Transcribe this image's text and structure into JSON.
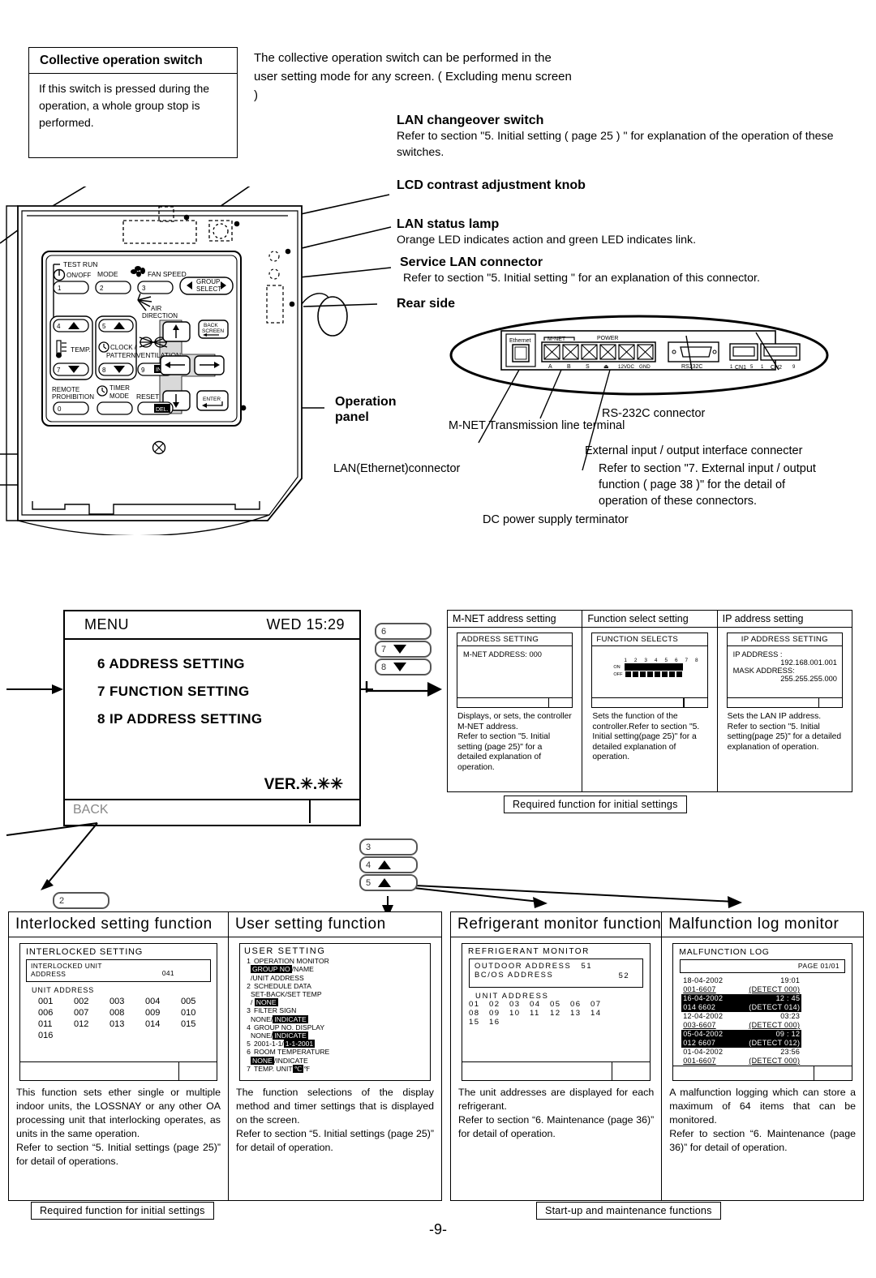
{
  "page_number": "-9-",
  "collective_box": {
    "title": "Collective operation switch",
    "body": "If this switch is pressed during the operation, a whole group stop is performed."
  },
  "intro_text": "The collective operation switch can be performed in the user setting mode for any screen. ( Excluding menu screen )",
  "callouts": [
    {
      "title": "LAN changeover switch",
      "body": "Refer to section \"5. Initial setting ( page 25 ) \" for explanation of the operation of these switches."
    },
    {
      "title": "LCD contrast adjustment knob",
      "body": ""
    },
    {
      "title": "LAN status lamp",
      "body": "Orange LED indicates action and green LED indicates link."
    },
    {
      "title": "Service LAN connector",
      "body": "Refer to section \"5. Initial setting \" for an explanation of this connector."
    },
    {
      "title": "Rear side",
      "body": ""
    }
  ],
  "operation_panel_label": "Operation\npanel",
  "panel_keys": {
    "test_run": "TEST RUN",
    "on_off": "ON/OFF",
    "mode": "MODE",
    "fan_speed": "FAN SPEED",
    "group_select": "GROUP\nSELECT",
    "air_direction": "AIR\nDIRECTION",
    "temp": "TEMP.",
    "clock_pattern": "CLOCK /\nPATTERN",
    "ventilation": "VENTILATION",
    "remote_prohibition": "REMOTE\nPROHIBITION",
    "timer_mode": "TIMER\nMODE",
    "reset": "RESET",
    "back_screen": "BACK\nSCREEN",
    "enter": "ENTER",
    "del": "DEL.",
    "ins": "INS.",
    "numbers": [
      "1",
      "2",
      "3",
      "4",
      "5",
      "6",
      "7",
      "8",
      "9",
      "0"
    ]
  },
  "rear_panel": {
    "ethernet": "Ethernet",
    "mnet": "M-NET",
    "power": "POWER",
    "terminal_labels": [
      "A",
      "B",
      "S",
      "⏚",
      "12VDC",
      "GND"
    ],
    "rs232c": "RS232C",
    "cn1": "CN1",
    "cn2": "CN2",
    "cn1_pins": [
      "1",
      "5"
    ],
    "cn2_pins": [
      "1",
      "9"
    ]
  },
  "rear_callouts": [
    {
      "text": "M-NET Transmission line terminal"
    },
    {
      "text": "RS-232C connector"
    },
    {
      "text": "LAN(Ethernet)connector"
    },
    {
      "text": "External input / output interface connecter"
    },
    {
      "text": "Refer to section \"7. External input / output function ( page 38 )\" for the detail of operation of these connectors."
    },
    {
      "text": "DC power supply terminator"
    }
  ],
  "menu_screen": {
    "title": "MENU",
    "clock": "WED 15:29",
    "items": [
      "6 ADDRESS SETTING",
      "7 FUNCTION SETTING",
      "8 IP ADDRESS SETTING"
    ],
    "version": "VER.✳.✳✳",
    "back": "BACK"
  },
  "key_group_top": [
    {
      "num": "6",
      "arrow": "none"
    },
    {
      "num": "7",
      "arrow": "down"
    },
    {
      "num": "8",
      "arrow": "down"
    }
  ],
  "key_group_bottom": [
    {
      "num": "3",
      "arrow": "none"
    },
    {
      "num": "4",
      "arrow": "up"
    },
    {
      "num": "5",
      "arrow": "up"
    }
  ],
  "key_group_left": [
    {
      "num": "2",
      "arrow": "none"
    }
  ],
  "settings_table": [
    {
      "header": "M-NET address setting",
      "screen_title": "ADDRESS SETTING",
      "screen_lines": [
        "M-NET ADDRESS: 000"
      ],
      "note": "Displays, or sets, the controller M-NET address.\nRefer to section \"5. Initial setting (page 25)\" for a detailed explanation of operation."
    },
    {
      "header": "Function select setting",
      "screen_title": "FUNCTION SELECTS",
      "dip_numbers": [
        "1",
        "2",
        "3",
        "4",
        "5",
        "6",
        "7",
        "8"
      ],
      "dip_on_label": "ON",
      "dip_off_label": "OFF",
      "note": "Sets the function of the controller.Refer to section \"5. Initial setting(page 25)\" for a detailed explanation of operation."
    },
    {
      "header": "IP address setting",
      "screen_title": "IP ADDRESS SETTING",
      "screen_lines": [
        "IP ADDRESS :",
        "192.168.001.001",
        "MASK ADDRESS:",
        "255.255.255.000"
      ],
      "note": "Sets the LAN IP address.\nRefer to section \"5. Initial setting(page 25)\" for a detailed explanation of operation."
    }
  ],
  "banner_initial_top": "Required function for initial settings",
  "banner_initial_bottom": "Required function for initial settings",
  "banner_startup": "Start-up and maintenance functions",
  "panels": [
    {
      "header": "Interlocked setting function",
      "screen": {
        "title": "INTERLOCKED SETTING",
        "sub_label": "INTERLOCKED UNIT\nADDRESS",
        "sub_value": "041",
        "unit_address_label": "UNIT ADDRESS",
        "addresses": [
          "001",
          "002",
          "003",
          "004",
          "005",
          "006",
          "007",
          "008",
          "009",
          "010",
          "011",
          "012",
          "013",
          "014",
          "015",
          "016"
        ]
      },
      "note": "This function sets ether single or multiple indoor units, the LOSSNAY or any other OA processing unit that interlocking operates, as units in the same operation.\nRefer to section “5. Initial settings (page 25)” for detail of operations."
    },
    {
      "header": "User setting function",
      "screen": {
        "title": "USER SETTING",
        "rows": [
          {
            "n": "1",
            "line1": "OPERATION MONITOR",
            "parts2": [
              {
                "t": "GROUP NO",
                "inv": true
              },
              {
                "t": "/NAME",
                "inv": false
              }
            ],
            "line3": "/UNIT ADDRESS"
          },
          {
            "n": "2",
            "line1": "SCHEDULE DATA",
            "line2": "SET-BACK/SET TEMP",
            "parts3": [
              {
                "t": "/ ",
                "inv": false
              },
              {
                "t": "NONE",
                "inv": true
              }
            ]
          },
          {
            "n": "3",
            "line1": "FILTER SIGN",
            "parts2": [
              {
                "t": "NONE/",
                "inv": false
              },
              {
                "t": "INDICATE",
                "inv": true
              }
            ]
          },
          {
            "n": "4",
            "line1": "GROUP NO. DISPLAY",
            "parts2": [
              {
                "t": "NONE/",
                "inv": false
              },
              {
                "t": "INDICATE",
                "inv": true
              }
            ]
          },
          {
            "n": "5",
            "parts1": [
              {
                "t": "2001-1-1/",
                "inv": false
              },
              {
                "t": "1-1-2001",
                "inv": true
              }
            ]
          },
          {
            "n": "6",
            "line1": "ROOM TEMPERATURE",
            "parts2": [
              {
                "t": "NONE",
                "inv": true
              },
              {
                "t": "/INDICATE",
                "inv": false
              }
            ]
          },
          {
            "n": "7",
            "parts1": [
              {
                "t": "TEMP. UNIT ",
                "inv": false
              },
              {
                "t": "℃",
                "inv": true
              },
              {
                "t": " ℉",
                "inv": false
              }
            ]
          }
        ]
      },
      "note": "The function selections of the display method and timer settings that is displayed on the screen.\nRefer to section “5. Initial settings (page 25)” for detail of operation."
    },
    {
      "header": "Refrigerant monitor function",
      "screen": {
        "title": "REFRIGERANT MONITOR",
        "outdoor_label": "OUTDOOR ADDRESS",
        "outdoor_value": "51",
        "bcos_label": "BC/OS ADDRESS",
        "bcos_value": "52",
        "unit_address_label": "UNIT ADDRESS",
        "addresses": [
          "01",
          "02",
          "03",
          "04",
          "05",
          "06",
          "07",
          "08",
          "09",
          "10",
          "11",
          "12",
          "13",
          "14",
          "15",
          "16"
        ]
      },
      "note": "The unit addresses are displayed for each refrigerant.\nRefer to section “6. Maintenance (page 36)” for detail of operation."
    },
    {
      "header": "Malfunction log monitor",
      "screen": {
        "title": "MALFUNCTION LOG",
        "page": "PAGE 01/01",
        "entries": [
          {
            "date": "18-04-2002",
            "time": "19:01",
            "code": "001-6607",
            "detect": "(DETECT  000)",
            "highlight": false
          },
          {
            "date": "16-04-2002",
            "time": "12 : 45",
            "code": "014 6602",
            "detect": "(DETECT  014)",
            "highlight": true
          },
          {
            "date": "12-04-2002",
            "time": "03:23",
            "code": "003-6607",
            "detect": "(DETECT  000)",
            "highlight": false
          },
          {
            "date": "05-04-2002",
            "time": "09 : 12",
            "code": "012 6607",
            "detect": "(DETECT  012)",
            "highlight": true
          },
          {
            "date": "01-04-2002",
            "time": "23:56",
            "code": "001-6607",
            "detect": "(DETECT  000)",
            "highlight": false
          }
        ]
      },
      "note": "A malfunction logging which can store a maximum of 64 items that can be monitored.\nRefer to section  “6. Maintenance (page 36)” for detail of operation."
    }
  ]
}
